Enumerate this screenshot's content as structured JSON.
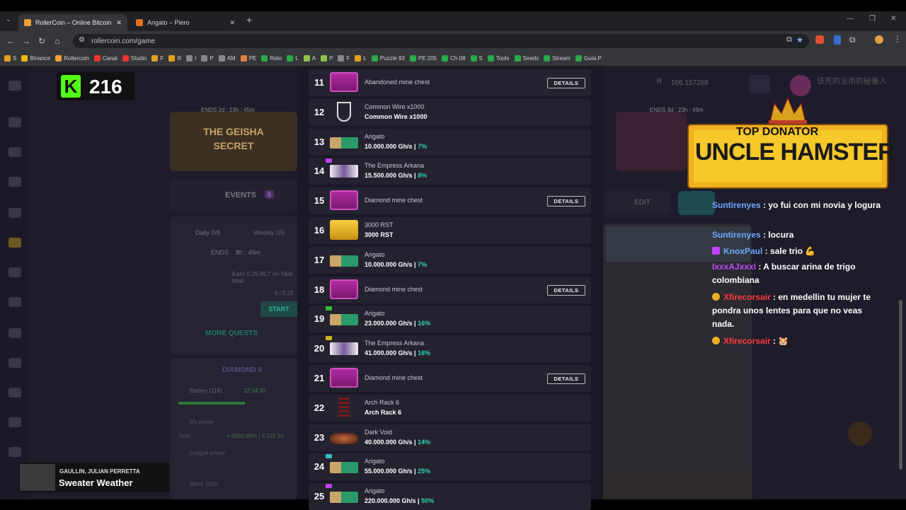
{
  "browser": {
    "tabs": [
      {
        "title": "RollerCoin – Online Bitcoin Min",
        "active": true
      },
      {
        "title": "Arigato – Piero",
        "active": false
      }
    ],
    "new_tab": "+",
    "url": "rollercoin.com/game",
    "bookmarks": [
      "S",
      "Binance",
      "Rollercoin",
      "Canal",
      "Studio",
      "F",
      "R",
      "I",
      "P",
      "AM",
      "PE",
      "Reto",
      "L",
      "A",
      "P",
      "F",
      "L",
      "Puzzle 93",
      "PE 205",
      "Ch 08",
      "S",
      "Tools",
      "Seeds",
      "Stream",
      "Guía P"
    ]
  },
  "overlay": {
    "kick_count": "216",
    "song_artist": "GAULLIN, JULIAN PERRETTA",
    "song_title": "Sweater Weather"
  },
  "game": {
    "left_event_ends": "ENDS  2d : 23h : 45m",
    "left_event_name": "THE GEISHA SECRET",
    "right_event_ends": "ENDS  3d : 23h : 45m",
    "events_label": "EVENTS",
    "events_count": "5",
    "tab_daily": "Daily  0/8",
    "tab_weekly": "Weekly  0/5",
    "quest_ends": "ENDS    8h : 45m",
    "quest_text": "Earn 0.25 RLT on Task Wall",
    "quest_progress": "0 / 0.25",
    "quest_start": "START",
    "more_quests": "MORE QUESTS",
    "league": "DIAMOND II",
    "battery_label": "Battery (118)",
    "battery_time": "12:14:30",
    "my_power": "My power",
    "total_label": "Total",
    "power_value": "+ 8593.88% | 3.229 Zh",
    "league_power": "League power",
    "block_label": "Block 1510",
    "balance": "106.157268",
    "edit": "EDIT",
    "username": "该死的没用的秘鲁人"
  },
  "items": [
    {
      "num": "11",
      "name": "Abandoned mine chest",
      "sub": "",
      "pct": "",
      "details": true,
      "thumb": "chest"
    },
    {
      "num": "12",
      "name": "Common Wire x1000",
      "sub": "Common Wire x1000",
      "pct": "",
      "details": false,
      "thumb": "wire"
    },
    {
      "num": "13",
      "name": "Arigato",
      "sub": "10.000.000 Gh/s | ",
      "pct": "7%",
      "details": false,
      "thumb": "miner"
    },
    {
      "num": "14",
      "name": "The Empress Arkana",
      "sub": "15.500.000 Gh/s | ",
      "pct": "8%",
      "details": false,
      "thumb": "empress"
    },
    {
      "num": "15",
      "name": "Diamond mine chest",
      "sub": "",
      "pct": "",
      "details": true,
      "thumb": "chest"
    },
    {
      "num": "16",
      "name": "3000 RST",
      "sub": "3000 RST",
      "pct": "",
      "details": false,
      "thumb": "gold"
    },
    {
      "num": "17",
      "name": "Arigato",
      "sub": "10.000.000 Gh/s | ",
      "pct": "7%",
      "details": false,
      "thumb": "miner"
    },
    {
      "num": "18",
      "name": "Diamond mine chest",
      "sub": "",
      "pct": "",
      "details": true,
      "thumb": "chest"
    },
    {
      "num": "19",
      "name": "Arigato",
      "sub": "23.000.000 Gh/s | ",
      "pct": "16%",
      "details": false,
      "thumb": "miner"
    },
    {
      "num": "20",
      "name": "The Empress Arkana",
      "sub": "41.000.000 Gh/s | ",
      "pct": "16%",
      "details": false,
      "thumb": "empress"
    },
    {
      "num": "21",
      "name": "Diamond mine chest",
      "sub": "",
      "pct": "",
      "details": true,
      "thumb": "chest"
    },
    {
      "num": "22",
      "name": "Arch Rack 6",
      "sub": "Arch Rack 6",
      "pct": "",
      "details": false,
      "thumb": "rack"
    },
    {
      "num": "23",
      "name": "Dark Void",
      "sub": "40.000.000 Gh/s | ",
      "pct": "14%",
      "details": false,
      "thumb": "void"
    },
    {
      "num": "24",
      "name": "Arigato",
      "sub": "55.000.000 Gh/s | ",
      "pct": "25%",
      "details": false,
      "thumb": "miner"
    },
    {
      "num": "25",
      "name": "Arigato",
      "sub": "220.000.000 Gh/s | ",
      "pct": "50%",
      "details": false,
      "thumb": "miner"
    }
  ],
  "details_label": "DETAILS",
  "donator": {
    "line1": "TOP DONATOR",
    "line2": "UNCLE HAMSTER"
  },
  "chat": [
    {
      "user": "Suntirenyes",
      "color": "#6ea8ff",
      "badge": "",
      "text": "yo fui con mi novia y logura"
    },
    {
      "user": "Suntirenyes",
      "color": "#6ea8ff",
      "badge": "",
      "text": "locura"
    },
    {
      "user": "KnoxPaul",
      "color": "#6ea8ff",
      "badge": "sub",
      "text": "sale trio 💪"
    },
    {
      "user": "IxxxAJxxxI",
      "color": "#c44bff",
      "badge": "",
      "text": "A buscar arina de trigo colombiana"
    },
    {
      "user": "Xfirecorsair",
      "color": "#ff3b3b",
      "badge": "gold",
      "text": "en medellin tu mujer te pondra unos lentes para que no veas nada."
    },
    {
      "user": "Xfirecorsair",
      "color": "#ff3b3b",
      "badge": "gold",
      "text": "🐹"
    }
  ]
}
